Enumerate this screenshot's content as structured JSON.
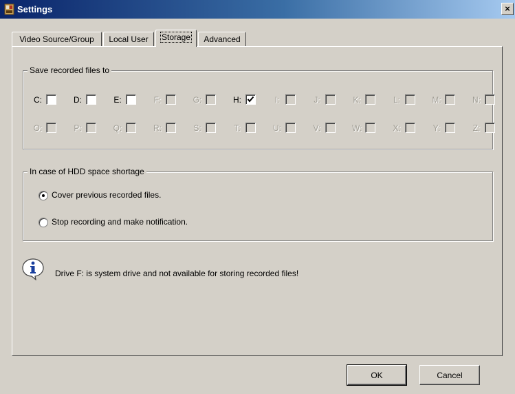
{
  "window": {
    "title": "Settings",
    "close_glyph": "×"
  },
  "tabs": [
    {
      "label": "Video Source/Group",
      "active": false
    },
    {
      "label": "Local User",
      "active": false
    },
    {
      "label": "Storage",
      "active": true
    },
    {
      "label": "Advanced",
      "active": false
    }
  ],
  "save_group": {
    "legend": "Save recorded files to",
    "drives_row1": [
      {
        "label": "C:",
        "enabled": true,
        "checked": false
      },
      {
        "label": "D:",
        "enabled": true,
        "checked": false
      },
      {
        "label": "E:",
        "enabled": true,
        "checked": false
      },
      {
        "label": "F:",
        "enabled": false,
        "checked": false
      },
      {
        "label": "G:",
        "enabled": false,
        "checked": false
      },
      {
        "label": "H:",
        "enabled": true,
        "checked": true
      },
      {
        "label": "I:",
        "enabled": false,
        "checked": false
      },
      {
        "label": "J:",
        "enabled": false,
        "checked": false
      },
      {
        "label": "K:",
        "enabled": false,
        "checked": false
      },
      {
        "label": "L:",
        "enabled": false,
        "checked": false
      },
      {
        "label": "M:",
        "enabled": false,
        "checked": false
      },
      {
        "label": "N:",
        "enabled": false,
        "checked": false
      }
    ],
    "drives_row2": [
      {
        "label": "O:",
        "enabled": false,
        "checked": false
      },
      {
        "label": "P:",
        "enabled": false,
        "checked": false
      },
      {
        "label": "Q:",
        "enabled": false,
        "checked": false
      },
      {
        "label": "R:",
        "enabled": false,
        "checked": false
      },
      {
        "label": "S:",
        "enabled": false,
        "checked": false
      },
      {
        "label": "T:",
        "enabled": false,
        "checked": false
      },
      {
        "label": "U:",
        "enabled": false,
        "checked": false
      },
      {
        "label": "V:",
        "enabled": false,
        "checked": false
      },
      {
        "label": "W:",
        "enabled": false,
        "checked": false
      },
      {
        "label": "X:",
        "enabled": false,
        "checked": false
      },
      {
        "label": "Y:",
        "enabled": false,
        "checked": false
      },
      {
        "label": "Z:",
        "enabled": false,
        "checked": false
      }
    ]
  },
  "shortage_group": {
    "legend": "In case of HDD space shortage",
    "options": [
      {
        "label": "Cover previous recorded files.",
        "selected": true
      },
      {
        "label": "Stop recording and make notification.",
        "selected": false
      }
    ]
  },
  "info": {
    "icon": "info-icon",
    "text": "Drive F: is system drive and not available for storing recorded files!"
  },
  "buttons": {
    "ok": "OK",
    "cancel": "Cancel"
  },
  "colors": {
    "title_start": "#0a246a",
    "title_end": "#a6caf0",
    "face": "#d4d0c8"
  }
}
